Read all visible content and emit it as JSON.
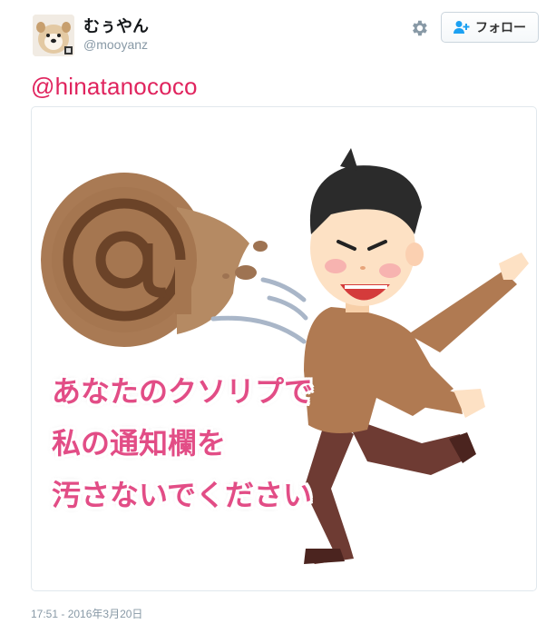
{
  "user": {
    "display_name": "むぅやん",
    "screen_name": "@mooyanz"
  },
  "header": {
    "follow_label": "フォロー"
  },
  "tweet": {
    "mention": "@hinatanococo",
    "timestamp": "17:51 - 2016年3月20日"
  },
  "media": {
    "caption_lines": [
      "あなたのクソリプで",
      "私の通知欄を",
      "汚さないでください"
    ]
  },
  "colors": {
    "mention": "#e0245e",
    "caption": "#e24d86",
    "meta_text": "#8899a6"
  }
}
